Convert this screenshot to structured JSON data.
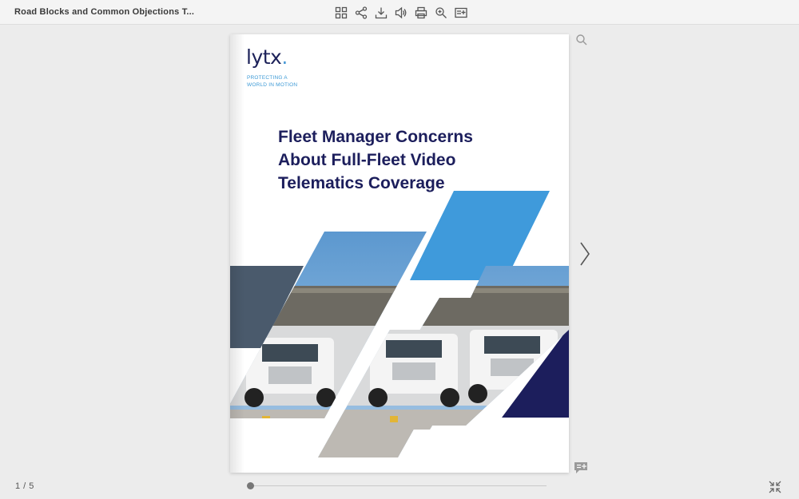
{
  "header": {
    "title": "Road Blocks and Common Objections T...",
    "tools": [
      {
        "icon": "grid-icon",
        "label": "Thumbnails"
      },
      {
        "icon": "share-icon",
        "label": "Share"
      },
      {
        "icon": "download-icon",
        "label": "Download"
      },
      {
        "icon": "sound-icon",
        "label": "Sound"
      },
      {
        "icon": "print-icon",
        "label": "Print"
      },
      {
        "icon": "zoom-icon",
        "label": "Zoom"
      },
      {
        "icon": "notes-icon",
        "label": "Notes"
      }
    ]
  },
  "document": {
    "logo_text": "lytx",
    "logo_dot": ".",
    "tagline_line1": "PROTECTING A",
    "tagline_line2": "WORLD IN MOTION",
    "headline_line1": "Fleet Manager Concerns",
    "headline_line2": "About Full-Fleet Video",
    "headline_line3": "Telematics Coverage"
  },
  "navigation": {
    "page_indicator": "1 / 5",
    "current_page": 1,
    "total_pages": 5
  },
  "colors": {
    "navy": "#1c1e5c",
    "accent_blue": "#3f9adb",
    "slate": "#4a5a6c"
  }
}
